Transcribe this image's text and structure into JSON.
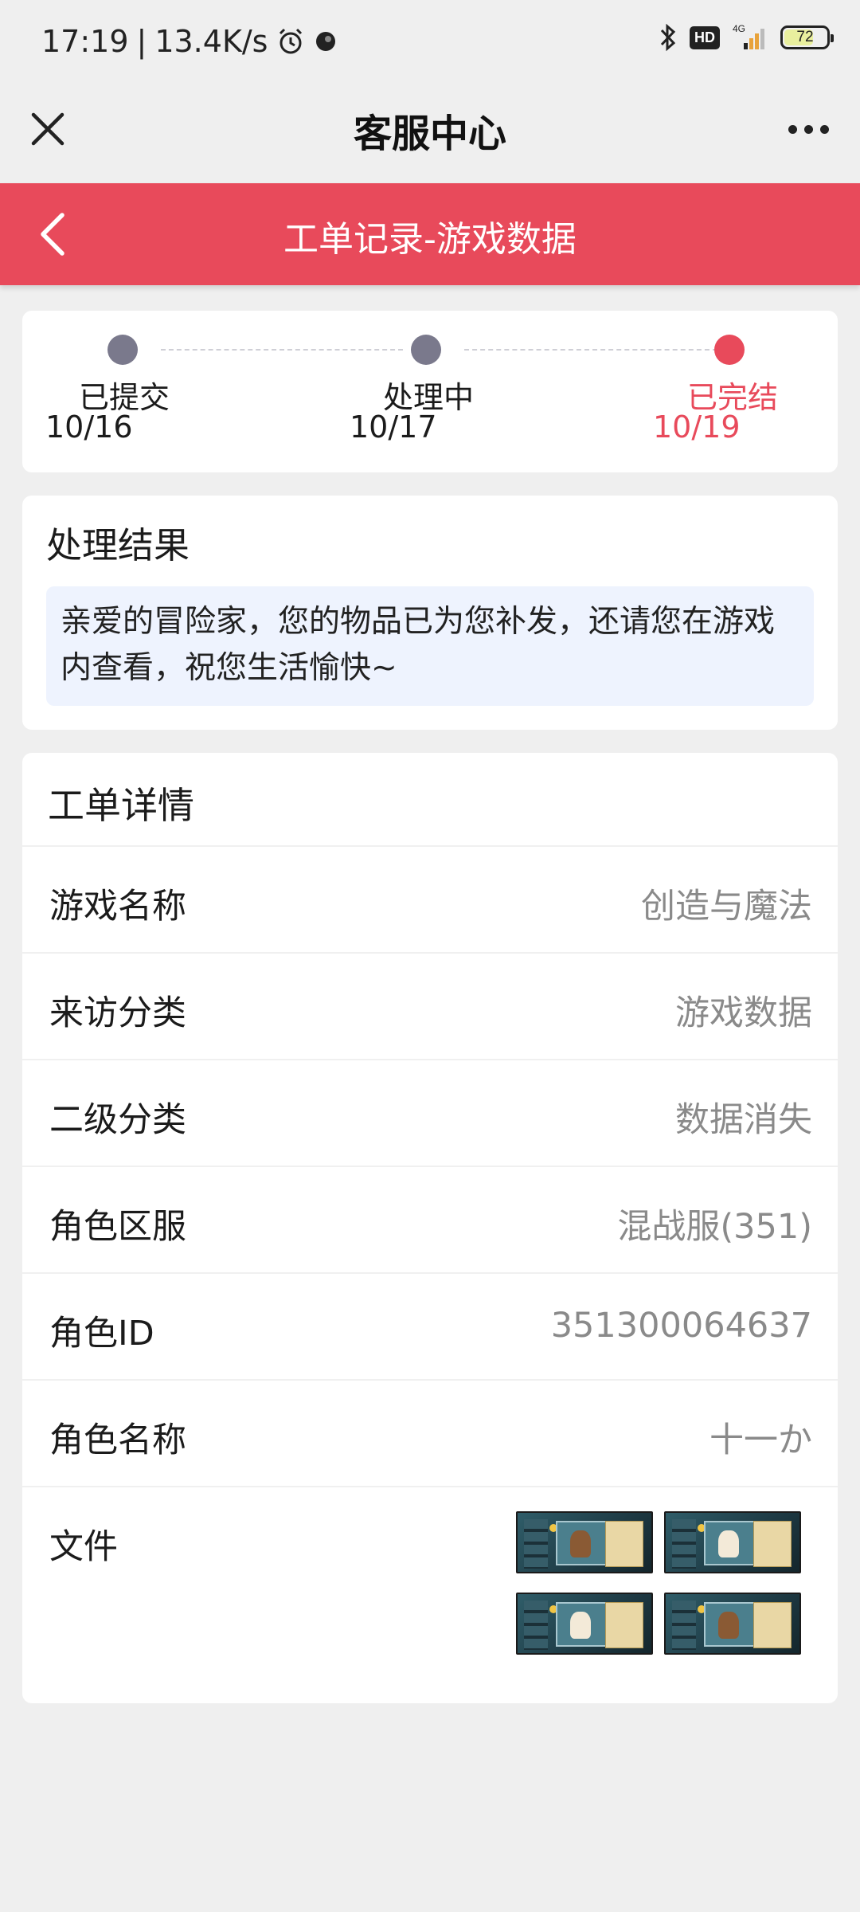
{
  "status_bar": {
    "time": "17:19",
    "separator": "|",
    "net_speed": "13.4K/s",
    "network": "4G",
    "hd_badge": "HD",
    "battery": "72",
    "battery_level": 0.72
  },
  "nav": {
    "title": "客服中心"
  },
  "header": {
    "title": "工单记录-游戏数据"
  },
  "progress": {
    "steps": [
      {
        "label": "已提交",
        "date": "10/16",
        "active": false
      },
      {
        "label": "处理中",
        "date": "10/17",
        "active": false
      },
      {
        "label": "已完结",
        "date": "10/19",
        "active": true
      }
    ]
  },
  "result": {
    "title": "处理结果",
    "text": "亲爱的冒险家，您的物品已为您补发，还请您在游戏内查看，祝您生活愉快~"
  },
  "details": {
    "title": "工单详情",
    "rows": [
      {
        "label": "游戏名称",
        "value": "创造与魔法"
      },
      {
        "label": "来访分类",
        "value": "游戏数据"
      },
      {
        "label": "二级分类",
        "value": "数据消失"
      },
      {
        "label": "角色区服",
        "value": "混战服(351)"
      },
      {
        "label": "角色ID",
        "value": "351300064637"
      },
      {
        "label": "角色名称",
        "value": "十一か"
      }
    ],
    "files_label": "文件",
    "files_count": 4
  },
  "colors": {
    "accent": "#e84a5b",
    "step_inactive": "#7a798c",
    "result_box": "#eef3fe",
    "value_text": "#8a8a8a"
  },
  "icons": {
    "close": "close-icon",
    "more": "more-icon",
    "back": "back-chevron-icon",
    "bluetooth": "bluetooth-icon",
    "alarm": "alarm-icon",
    "signal": "signal-icon"
  }
}
